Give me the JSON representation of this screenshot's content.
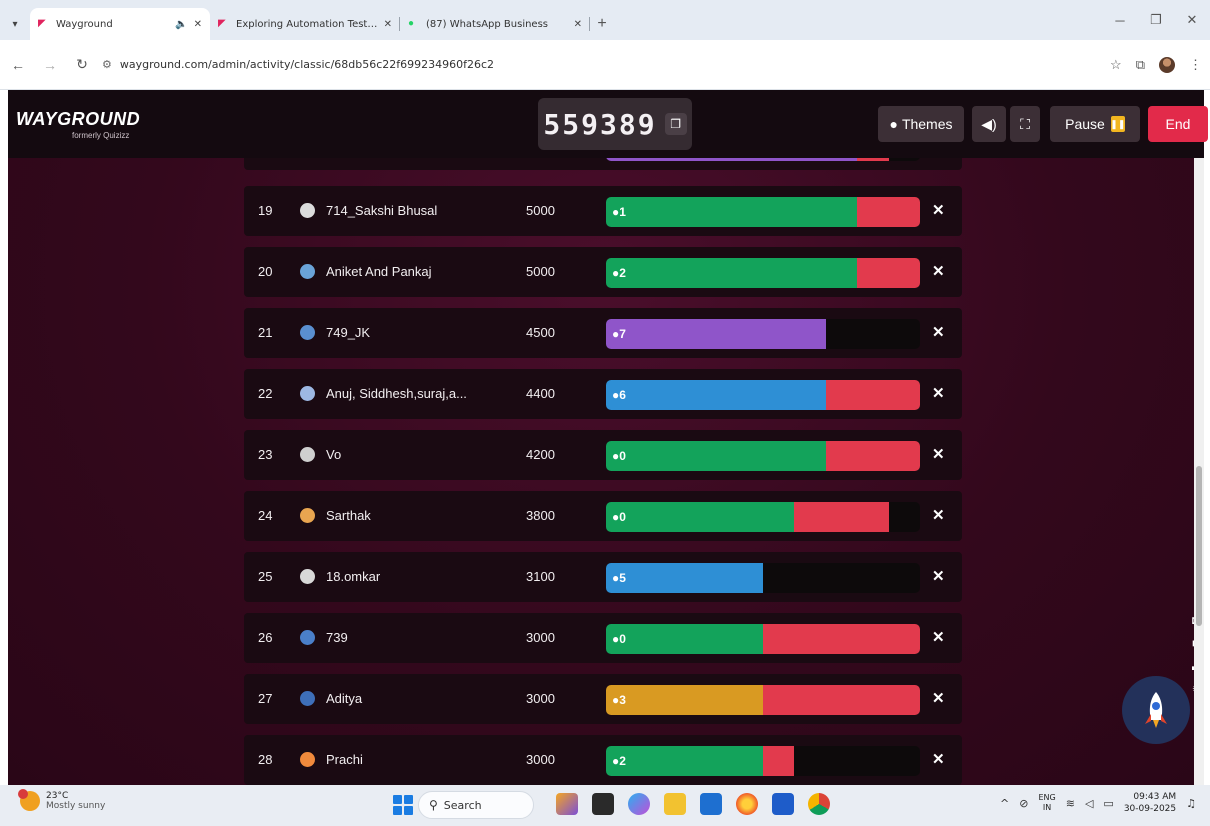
{
  "browser": {
    "tabs": [
      {
        "title": "Wayground",
        "favicon": "wayground-logo-icon",
        "active": true
      },
      {
        "title": "Exploring Automation Testing",
        "favicon": "wayground-logo-icon",
        "active": false
      },
      {
        "title": "(87) WhatsApp Business",
        "favicon": "whatsapp-icon",
        "active": false
      }
    ],
    "url": "wayground.com/admin/activity/classic/68db56c22f699234960f26c2"
  },
  "app": {
    "logo_text": "WAYGROUND",
    "logo_subtext": "formerly Quizizz",
    "game_code": "559389",
    "themes_label": "Themes",
    "pause_label": "Pause",
    "end_label": "End"
  },
  "leaderboard": {
    "rows": [
      {
        "rank": "19",
        "name": "714_Sakshi Bhusal",
        "score": "5000",
        "streak": "1",
        "accent": "#13a35b",
        "accent_pct": 80,
        "red_pct": 20
      },
      {
        "rank": "20",
        "name": "Aniket And Pankaj",
        "score": "5000",
        "streak": "2",
        "accent": "#13a35b",
        "accent_pct": 80,
        "red_pct": 20
      },
      {
        "rank": "21",
        "name": "749_JK",
        "score": "4500",
        "streak": "7",
        "accent": "#8f55c9",
        "accent_pct": 70,
        "red_pct": 0
      },
      {
        "rank": "22",
        "name": "Anuj, Siddhesh,suraj,a...",
        "score": "4400",
        "streak": "6",
        "accent": "#2e8fd5",
        "accent_pct": 70,
        "red_pct": 30
      },
      {
        "rank": "23",
        "name": "Vo",
        "score": "4200",
        "streak": "0",
        "accent": "#13a35b",
        "accent_pct": 70,
        "red_pct": 30
      },
      {
        "rank": "24",
        "name": "Sarthak",
        "score": "3800",
        "streak": "0",
        "accent": "#13a35b",
        "accent_pct": 60,
        "red_pct": 30
      },
      {
        "rank": "25",
        "name": "18.omkar",
        "score": "3100",
        "streak": "5",
        "accent": "#2e8fd5",
        "accent_pct": 50,
        "red_pct": 0
      },
      {
        "rank": "26",
        "name": "739",
        "score": "3000",
        "streak": "0",
        "accent": "#13a35b",
        "accent_pct": 50,
        "red_pct": 50
      },
      {
        "rank": "27",
        "name": "Aditya",
        "score": "3000",
        "streak": "3",
        "accent": "#d99a22",
        "accent_pct": 50,
        "red_pct": 50
      },
      {
        "rank": "28",
        "name": "Prachi",
        "score": "3000",
        "streak": "2",
        "accent": "#13a35b",
        "accent_pct": 50,
        "red_pct": 10
      }
    ]
  },
  "taskbar": {
    "temperature": "23°C",
    "condition": "Mostly sunny",
    "search_label": "Search",
    "lang_1": "ENG",
    "lang_2": "IN",
    "time": "09:43 AM",
    "date": "30-09-2025"
  }
}
